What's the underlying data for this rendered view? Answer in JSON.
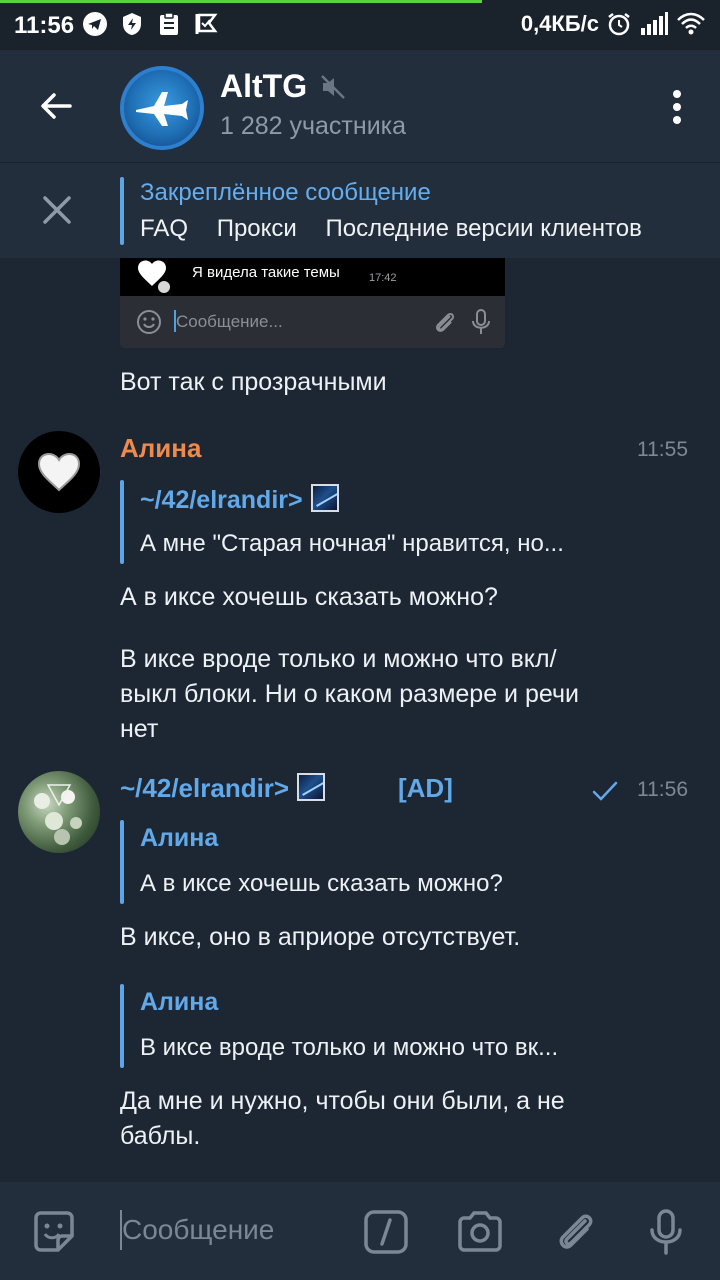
{
  "status_bar": {
    "time": "11:56",
    "net_speed": "0,4КБ/с",
    "progress_fraction": 0.67
  },
  "header": {
    "title": "AltTG",
    "subtitle": "1 282 участника",
    "muted_icon": "muted-speaker-icon"
  },
  "pinned": {
    "title": "Закреплённое сообщение",
    "items": [
      "FAQ",
      "Прокси",
      "Последние версии клиентов"
    ]
  },
  "messages": {
    "image_preview": {
      "text": "Я видела такие темы",
      "time": "17:42",
      "input_placeholder": "Сообщение..."
    },
    "msg0_text": "Вот так с прозрачными",
    "msg1": {
      "sender": "Алина",
      "time": "11:55",
      "reply_name": "~/42/elrandir>",
      "reply_text": "А мне \"Старая ночная\" нравится, но...",
      "text1": "А в иксе хочешь сказать можно?",
      "text2_line1": "В иксе вроде только и можно что вкл/",
      "text2_line2": "выкл блоки. Ни о каком размере и речи",
      "text2_line3": "нет"
    },
    "msg2": {
      "sender": "~/42/elrandir>",
      "tag": "[AD]",
      "time": "11:56",
      "reply1_name": "Алина",
      "reply1_text": "А в иксе хочешь сказать можно?",
      "text1": "В иксе, оно в априоре отсутствует.",
      "reply2_name": "Алина",
      "reply2_text": "В иксе вроде только и можно что вк...",
      "text2_line1": "Да мне и нужно, чтобы они были, а не",
      "text2_line2": "баблы."
    }
  },
  "input": {
    "placeholder": "Сообщение"
  },
  "colors": {
    "background": "#1d2733",
    "header": "#232e3c",
    "accent": "#62a9ea",
    "sender_orange": "#ee8a4e"
  }
}
